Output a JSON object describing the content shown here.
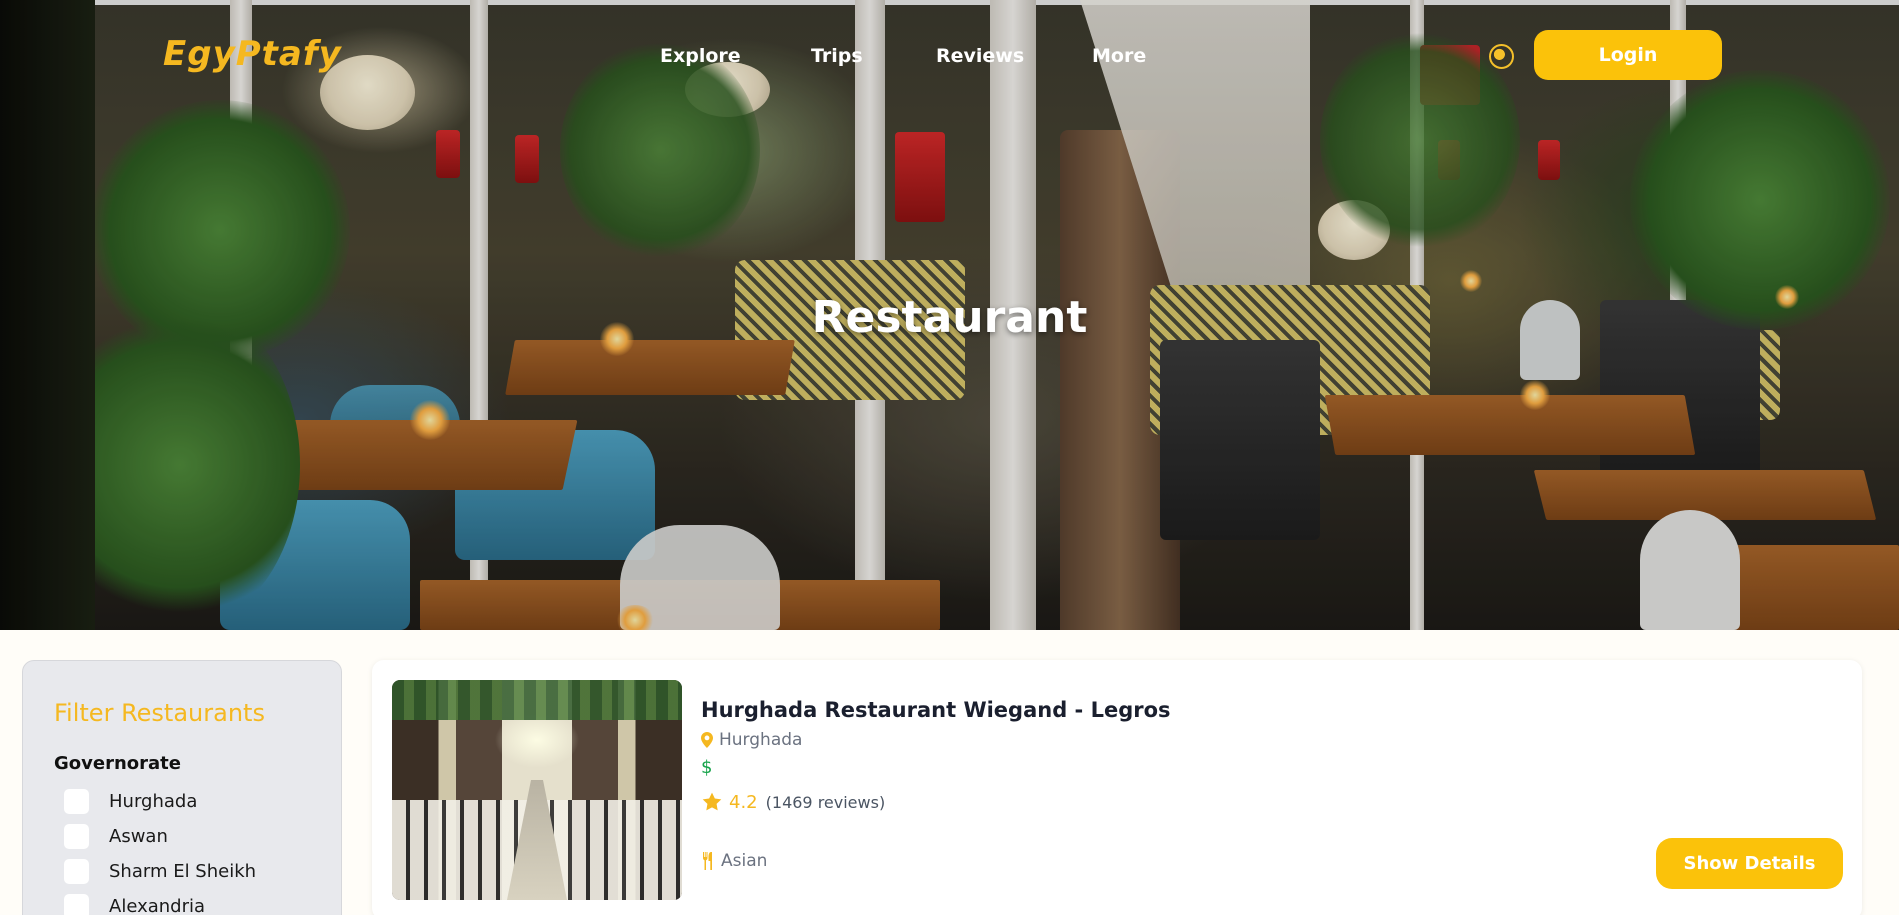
{
  "header": {
    "logo_text": "EgyPtafy",
    "nav": [
      {
        "label": "Explore"
      },
      {
        "label": "Trips"
      },
      {
        "label": "Reviews"
      },
      {
        "label": "More"
      }
    ],
    "language_icon": "globe-icon",
    "login_label": "Login"
  },
  "hero": {
    "title": "Restaurant"
  },
  "filter": {
    "title": "Filter Restaurants",
    "section_title": "Governorate",
    "options": [
      {
        "label": "Hurghada"
      },
      {
        "label": "Aswan"
      },
      {
        "label": "Sharm El Sheikh"
      },
      {
        "label": "Alexandria"
      }
    ]
  },
  "results": [
    {
      "name": "Hurghada Restaurant Wiegand - Legros",
      "location": "Hurghada",
      "price": "$",
      "rating": "4.2",
      "reviews": "(1469 reviews)",
      "cuisine": "Asian",
      "details_label": "Show Details"
    }
  ],
  "colors": {
    "accent": "#fbc20a",
    "accent_text": "#f5b820",
    "price_green": "#16a34a"
  }
}
